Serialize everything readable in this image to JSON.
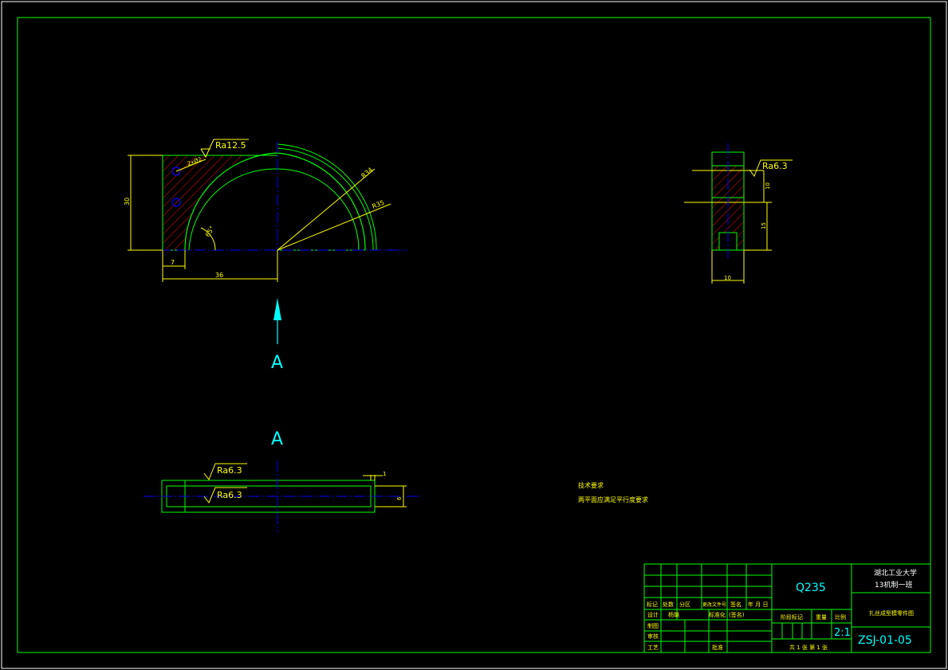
{
  "colors": {
    "background": "#000000",
    "frame": "#00ff00",
    "dimension": "#ffff00",
    "centerline": "#0000ff",
    "hatch": "#ff0000",
    "view_arrow": "#00ffff",
    "text": "#ffffff"
  },
  "view_label": "A",
  "front_view": {
    "roughness": "Ra12.5",
    "hole_callout": "2xØ2",
    "angle": "65°",
    "radius_inner": "R34",
    "radius_outer": "R35",
    "dim_height": "30",
    "dim_offset": "7",
    "dim_width": "36"
  },
  "side_view": {
    "roughness": "Ra6.3",
    "dim_10_vertical": "10",
    "dim_15": "15",
    "dim_10_horizontal": "10"
  },
  "bottom_view": {
    "roughness_top": "Ra6.3",
    "roughness_bottom": "Ra6.3",
    "dim_1": "1",
    "dim_6": "6"
  },
  "tech_notes": {
    "heading": "技术要求",
    "line1": "两平面应满足平行度要求"
  },
  "title_block": {
    "material": "Q235",
    "school": "湖北工业大学",
    "class": "13机制一班",
    "part_name": "扎丝成型模零件图",
    "drawing_no": "ZSJ-01-05",
    "scale": "2:1",
    "sheets": "共 1 张  第 1 张",
    "col_headers": [
      "标记",
      "处数",
      "分区",
      "更改文件号",
      "签名",
      "年 月 日"
    ],
    "stage_label": "阶段标记",
    "weight_label": "重量",
    "scale_label": "比例",
    "row_design": "设计",
    "row_design_name": "杨璐",
    "row_standard": "标准化",
    "row_sign": "(签名)",
    "row_draw": "制图",
    "row_review": "审核",
    "row_process": "工艺",
    "row_approve": "批准"
  }
}
